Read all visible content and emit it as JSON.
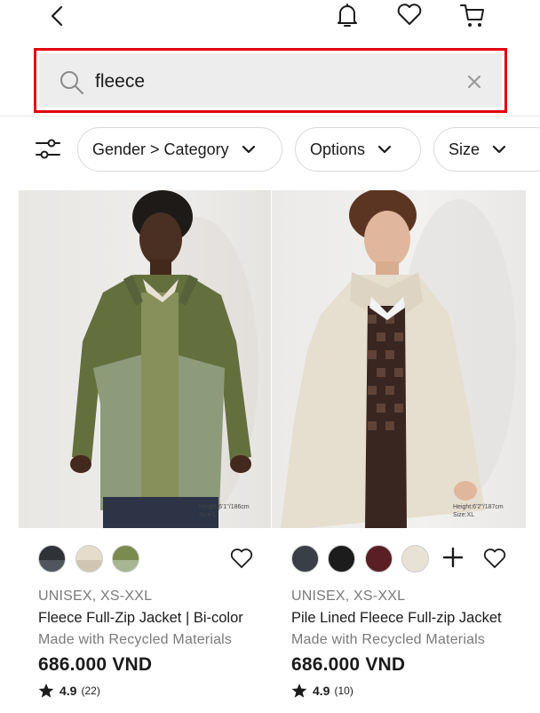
{
  "header": {
    "icons": [
      "back-icon",
      "bell-icon",
      "heart-icon",
      "cart-icon"
    ]
  },
  "search": {
    "value": "fleece",
    "placeholder": "Search",
    "highlight_color": "#e3000f"
  },
  "filters": [
    {
      "label": "Gender > Category"
    },
    {
      "label": "Options"
    },
    {
      "label": "Size"
    }
  ],
  "products": [
    {
      "image_caption": "Height:6'1\"/186cm\nSize:L",
      "colors": [
        "#2f3338",
        "#e6dccb",
        "#7b8a4f"
      ],
      "size_line": "UNISEX, XS-XXL",
      "name": "Fleece Full-Zip Jacket | Bi-color",
      "sub": "Made with Recycled Materials",
      "price": "686.000 VND",
      "rating": "4.9",
      "reviews": "(22)"
    },
    {
      "image_caption": "Height:6'2\"/187cm\nSize:XL",
      "colors": [
        "#3a3f47",
        "#1c1c1c",
        "#5a1f24",
        "#e8e2d6"
      ],
      "size_line": "UNISEX, XS-XXL",
      "name": "Pile Lined Fleece Full-zip Jacket",
      "sub": "Made with Recycled Materials",
      "price": "686.000 VND",
      "rating": "4.9",
      "reviews": "(10)"
    }
  ]
}
